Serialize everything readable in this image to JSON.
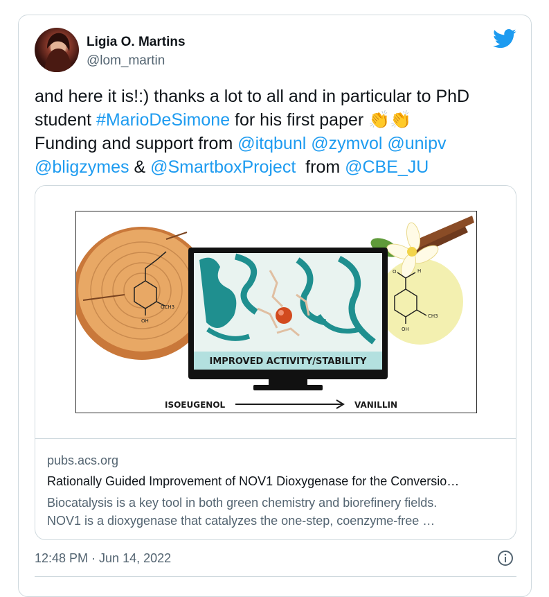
{
  "author": {
    "name": "Ligia O. Martins",
    "handle": "@lom_martin",
    "avatar_icon": "profile-photo"
  },
  "brand_icon": "twitter-bird-icon",
  "tweet": {
    "line1": "and here it is!:) thanks a lot to all and in particular to PhD",
    "line2_prefix": "student ",
    "hashtag": "#MarioDeSimone",
    "line2_suffix": " for his first paper ",
    "emoji": "👏👏",
    "line3_prefix": "Funding and support from ",
    "mention_1": "@itqbunl",
    "mention_2": "@zymvol",
    "mention_3": "@unipv",
    "mention_4": "@bligzymes",
    "amp": " & ",
    "mention_5": "@SmartboxProject",
    "from_text": "  from ",
    "mention_6": "@CBE_JU"
  },
  "link_card": {
    "image_labels": {
      "banner": "IMPROVED ACTIVITY/STABILITY",
      "left": "ISOEUGENOL",
      "right": "VANILLIN",
      "oh_left": "OH",
      "och3_left": "OCH3",
      "oh_right": "OH",
      "h_right": "H",
      "o_right": "O",
      "ch3_right": "CH3"
    },
    "domain": "pubs.acs.org",
    "title": "Rationally Guided Improvement of NOV1 Dioxygenase for the Conversio…",
    "description_line1": "Biocatalysis is a key tool in both green chemistry and biorefinery fields.",
    "description_line2": "NOV1 is a dioxygenase that catalyzes the one-step, coenzyme-free …"
  },
  "timestamp": "12:48 PM · Jun 14, 2022",
  "colors": {
    "link": "#1d9bf0",
    "text": "#0f1419",
    "muted": "#536471",
    "border": "#cfd9de",
    "banner": "#b3e0df",
    "wood": "#e8a865",
    "protein": "#1f8f8f"
  }
}
